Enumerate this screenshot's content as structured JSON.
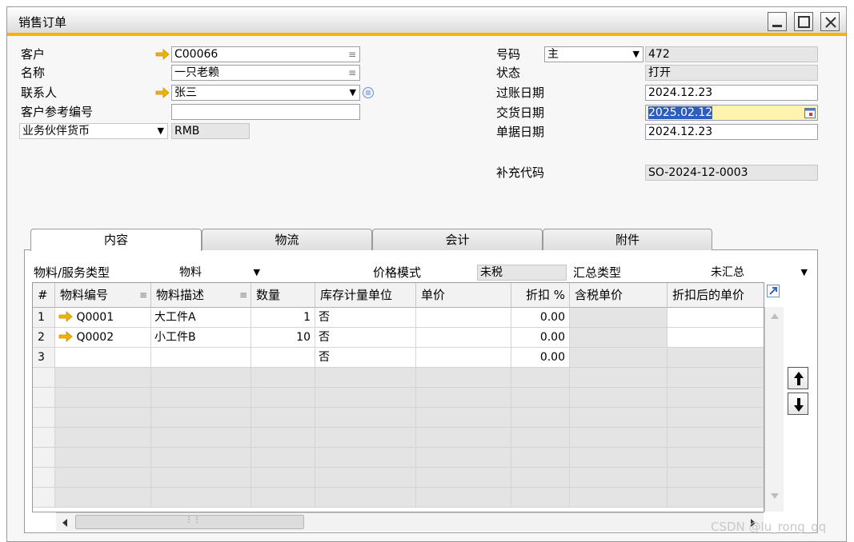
{
  "window": {
    "title": "销售订单"
  },
  "header_left": {
    "customer_label": "客户",
    "customer_value": "C00066",
    "name_label": "名称",
    "name_value": "一只老赖",
    "contact_label": "联系人",
    "contact_value": "张三",
    "ref_label": "客户参考编号",
    "ref_value": "",
    "currency_label": "业务伙伴货币",
    "currency_value": "RMB"
  },
  "header_right": {
    "number_label": "号码",
    "number_series": "主",
    "number_value": "472",
    "status_label": "状态",
    "status_value": "打开",
    "posting_label": "过账日期",
    "posting_value": "2024.12.23",
    "delivery_label": "交货日期",
    "delivery_value": "2025.02.12",
    "doc_label": "单据日期",
    "doc_value": "2024.12.23",
    "extra_label": "补充代码",
    "extra_value": "SO-2024-12-0003"
  },
  "tabs": [
    {
      "label": "内容",
      "active": true
    },
    {
      "label": "物流",
      "active": false
    },
    {
      "label": "会计",
      "active": false
    },
    {
      "label": "附件",
      "active": false
    }
  ],
  "content": {
    "item_type_label": "物料/服务类型",
    "item_type_value": "物料",
    "price_mode_label": "价格模式",
    "price_mode_value": "未税",
    "summary_label": "汇总类型",
    "summary_value": "未汇总"
  },
  "grid": {
    "columns": [
      "#",
      "物料编号",
      "物料描述",
      "数量",
      "库存计量单位",
      "单价",
      "折扣 %",
      "含税单价",
      "折扣后的单价"
    ],
    "rows": [
      {
        "num": "1",
        "code": "Q0001",
        "desc": "大工件A",
        "qty": "1",
        "uom": "否",
        "price": "",
        "discount": "0.00"
      },
      {
        "num": "2",
        "code": "Q0002",
        "desc": "小工件B",
        "qty": "10",
        "uom": "否",
        "price": "",
        "discount": "0.00"
      },
      {
        "num": "3",
        "code": "",
        "desc": "",
        "qty": "",
        "uom": "否",
        "price": "",
        "discount": "0.00"
      }
    ]
  },
  "watermark": "CSDN @lu_rong_qq",
  "colors": {
    "accent": "#f5b400",
    "link_arrow": "#f0b400",
    "selection": "#2d5ebd"
  }
}
